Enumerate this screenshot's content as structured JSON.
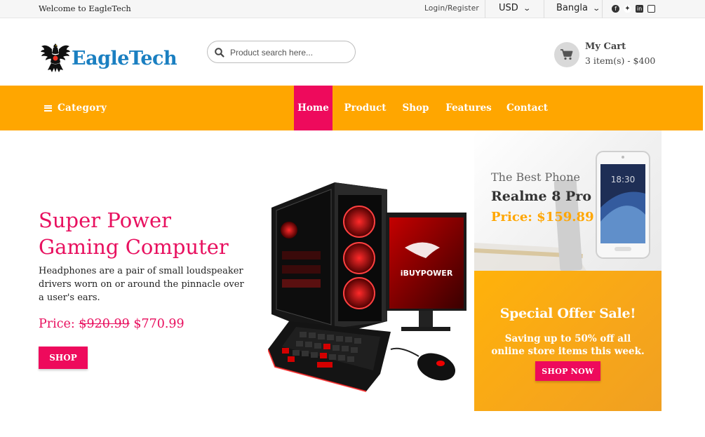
{
  "topbar": {
    "welcome": "Welcome to EagleTech",
    "login_register": "Login/Register",
    "currency": "USD",
    "language": "Bangla",
    "social_icons": [
      "facebook-icon",
      "twitter-icon",
      "linkedin-icon",
      "instagram-icon"
    ]
  },
  "header": {
    "brand": "EagleTech",
    "search_placeholder": "Product search here...",
    "cart_title": "My Cart",
    "cart_summary": "3 item(s) - $400"
  },
  "nav": {
    "category_label": "Category",
    "items": [
      "Home",
      "Product",
      "Shop",
      "Features",
      "Contact"
    ],
    "active": "Home"
  },
  "hero": {
    "title_line1": "Super Power",
    "title_line2": "Gaming Computer",
    "description": "Headphones are a pair of small loudspeaker drivers worn on or around the pinnacle over a user's ears.",
    "price_label": "Price:",
    "old_price": "$920.99",
    "new_price": "$770.99",
    "button": "SHOP",
    "image_brand_text": "iBUYPOWER"
  },
  "phone_banner": {
    "subtitle": "The Best Phone",
    "name": "Realme 8 Pro",
    "price": "Price: $159.89",
    "screen_time": "18:30"
  },
  "offer_banner": {
    "title": "Special Offer Sale!",
    "description": "Saving up to 50% off all online store items this week.",
    "button": "SHOP NOW"
  },
  "colors": {
    "accent_pink": "#ee0a5c",
    "nav_orange": "#ffa600",
    "brand_blue": "#1a7fc1"
  }
}
